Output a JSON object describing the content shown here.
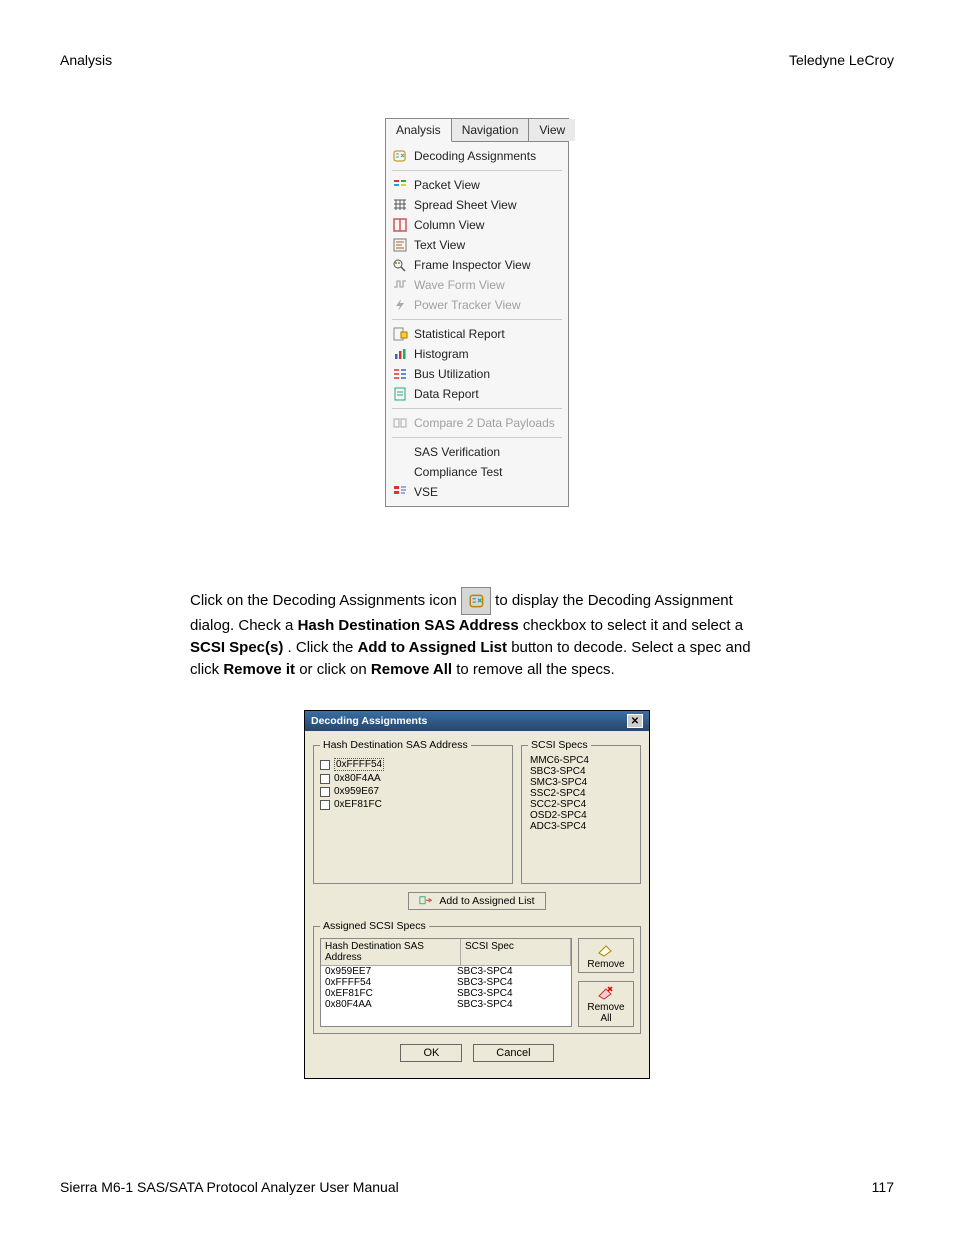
{
  "header": {
    "left": "Analysis",
    "right": "Teledyne LeCroy"
  },
  "menu": {
    "tabs": [
      "Analysis",
      "Navigation",
      "View"
    ],
    "group1": [
      {
        "icon": "decoding-icon",
        "label": "Decoding Assignments",
        "disabled": false
      }
    ],
    "group2": [
      {
        "icon": "packet-view-icon",
        "label": "Packet View",
        "disabled": false
      },
      {
        "icon": "spreadsheet-icon",
        "label": "Spread Sheet View",
        "disabled": false
      },
      {
        "icon": "column-view-icon",
        "label": "Column View",
        "disabled": false
      },
      {
        "icon": "text-view-icon",
        "label": "Text View",
        "disabled": false
      },
      {
        "icon": "frame-inspector-icon",
        "label": "Frame Inspector View",
        "disabled": false
      },
      {
        "icon": "waveform-icon",
        "label": "Wave Form View",
        "disabled": true
      },
      {
        "icon": "power-tracker-icon",
        "label": "Power Tracker View",
        "disabled": true
      }
    ],
    "group3": [
      {
        "icon": "stat-report-icon",
        "label": "Statistical Report",
        "disabled": false
      },
      {
        "icon": "histogram-icon",
        "label": "Histogram",
        "disabled": false
      },
      {
        "icon": "bus-util-icon",
        "label": "Bus Utilization",
        "disabled": false
      },
      {
        "icon": "data-report-icon",
        "label": "Data Report",
        "disabled": false
      }
    ],
    "group4": [
      {
        "icon": "compare-icon",
        "label": "Compare 2 Data Payloads",
        "disabled": true
      }
    ],
    "group5": [
      {
        "icon": "",
        "label": "SAS Verification",
        "disabled": false
      },
      {
        "icon": "",
        "label": "Compliance Test",
        "disabled": false
      },
      {
        "icon": "vse-icon",
        "label": "VSE",
        "disabled": false
      }
    ]
  },
  "paragraph": {
    "pre_icon": "Click on the Decoding Assignments icon ",
    "after_icon": " to display the Decoding Assignment dialog. Check a ",
    "b1": "Hash Destination SAS Address",
    "mid1": " checkbox to select it and select a ",
    "b2": "SCSI Spec(s)",
    "mid2": ". Click the ",
    "b3": "Add to Assigned List",
    "mid3": " button to decode. Select a spec and click ",
    "b4": "Remove it",
    "mid4": " or click on ",
    "b5": "Remove All",
    "mid5": " to remove all the specs."
  },
  "dialog": {
    "title": "Decoding Assignments",
    "hash_legend": "Hash Destination SAS Address",
    "hash_items": [
      "0xFFFF54",
      "0x80F4AA",
      "0x959E67",
      "0xEF81FC"
    ],
    "scsi_legend": "SCSI Specs",
    "scsi_items": [
      "MMC6-SPC4",
      "SBC3-SPC4",
      "SMC3-SPC4",
      "SSC2-SPC4",
      "SCC2-SPC4",
      "OSD2-SPC4",
      "ADC3-SPC4"
    ],
    "add_label": "Add  to Assigned List",
    "assigned_legend": "Assigned SCSI Specs",
    "table_headers": {
      "c1": "Hash Destination SAS Address",
      "c2": "SCSI Spec"
    },
    "rows": [
      {
        "addr": "0x959EE7",
        "spec": "SBC3-SPC4"
      },
      {
        "addr": "0xFFFF54",
        "spec": "SBC3-SPC4"
      },
      {
        "addr": "0xEF81FC",
        "spec": "SBC3-SPC4"
      },
      {
        "addr": "0x80F4AA",
        "spec": "SBC3-SPC4"
      }
    ],
    "remove_label": "Remove",
    "remove_all_label": "Remove All",
    "ok_label": "OK",
    "cancel_label": "Cancel"
  },
  "footer": {
    "left": "Sierra M6-1 SAS/SATA Protocol Analyzer User Manual",
    "right": "117"
  }
}
